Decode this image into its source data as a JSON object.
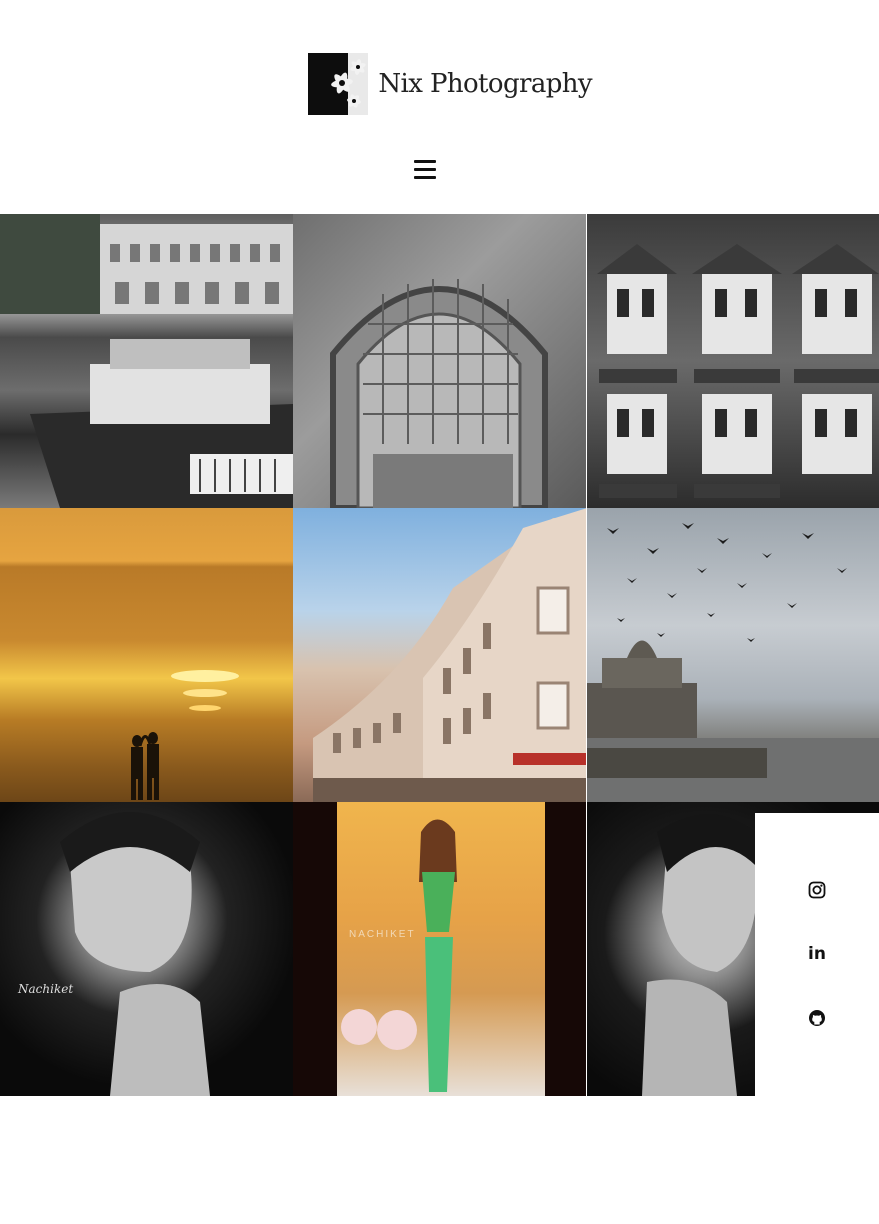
{
  "header": {
    "logo_text": "Nix Photography"
  },
  "gallery": {
    "tiles": [
      {
        "name": "harbour-boats-photo",
        "style": "bw"
      },
      {
        "name": "carved-arch-photo",
        "style": "bw"
      },
      {
        "name": "hotel-windows-photo",
        "style": "bw"
      },
      {
        "name": "beach-sunset-photo",
        "style": "color"
      },
      {
        "name": "curved-building-photo",
        "style": "color"
      },
      {
        "name": "gateway-birds-photo",
        "style": "color"
      },
      {
        "name": "portrait-woman-photo",
        "style": "bw"
      },
      {
        "name": "fashion-model-photo",
        "style": "color"
      },
      {
        "name": "portrait-woman-2-photo",
        "style": "bw"
      }
    ],
    "watermark_1": "Nachiket",
    "watermark_2": "NACHIKET"
  },
  "social": {
    "icons": [
      "instagram-icon",
      "linkedin-icon",
      "github-icon"
    ],
    "linkedin_text": "in"
  },
  "colors": {
    "background": "#ffffff",
    "text": "#111111"
  }
}
